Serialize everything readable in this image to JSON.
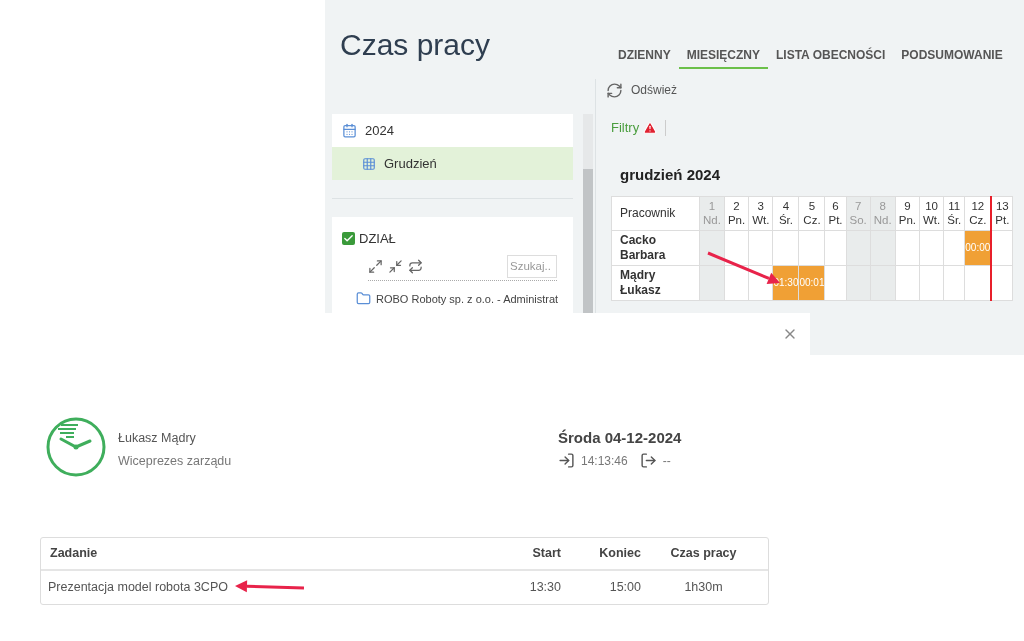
{
  "page": {
    "title": "Czas pracy"
  },
  "tabs": [
    {
      "label": "DZIENNY",
      "selected": false
    },
    {
      "label": "MIESIĘCZNY",
      "selected": true
    },
    {
      "label": "LISTA OBECNOŚCI",
      "selected": false
    },
    {
      "label": "PODSUMOWANIE",
      "selected": false
    }
  ],
  "toolbar": {
    "refresh": "Odśwież"
  },
  "filters": {
    "label": "Filtry",
    "warning": true
  },
  "calendar_tree": [
    {
      "label": "2024",
      "selected": false,
      "children": [
        {
          "label": "Grudzień",
          "selected": true
        }
      ]
    }
  ],
  "department": {
    "label": "DZIAŁ",
    "checked": true,
    "search_placeholder": "Szukaj..",
    "items": [
      {
        "label": "ROBO Roboty sp. z o.o. - Administrat"
      }
    ]
  },
  "schedule": {
    "title": "grudzień 2024",
    "employee_column": "Pracownik",
    "days": [
      {
        "day": "1",
        "weekday": "Nd.",
        "weekend": true,
        "today": false
      },
      {
        "day": "2",
        "weekday": "Pn.",
        "weekend": false,
        "today": false
      },
      {
        "day": "3",
        "weekday": "Wt.",
        "weekend": false,
        "today": false
      },
      {
        "day": "4",
        "weekday": "Śr.",
        "weekend": false,
        "today": false
      },
      {
        "day": "5",
        "weekday": "Cz.",
        "weekend": false,
        "today": false
      },
      {
        "day": "6",
        "weekday": "Pt.",
        "weekend": false,
        "today": false
      },
      {
        "day": "7",
        "weekday": "So.",
        "weekend": true,
        "today": false
      },
      {
        "day": "8",
        "weekday": "Nd.",
        "weekend": true,
        "today": false
      },
      {
        "day": "9",
        "weekday": "Pn.",
        "weekend": false,
        "today": false
      },
      {
        "day": "10",
        "weekday": "Wt.",
        "weekend": false,
        "today": false
      },
      {
        "day": "11",
        "weekday": "Śr.",
        "weekend": false,
        "today": false
      },
      {
        "day": "12",
        "weekday": "Cz.",
        "weekend": false,
        "today": false
      },
      {
        "day": "13",
        "weekday": "Pt.",
        "weekend": false,
        "today": true
      }
    ],
    "rows": [
      {
        "name": "Cacko Barbara",
        "cells": [
          {
            "filled": false
          },
          {
            "filled": false
          },
          {
            "filled": false
          },
          {
            "filled": false
          },
          {
            "filled": false
          },
          {
            "filled": false
          },
          {
            "filled": false
          },
          {
            "filled": false
          },
          {
            "filled": false
          },
          {
            "filled": false
          },
          {
            "filled": false
          },
          {
            "filled": true,
            "time": "00:00"
          },
          {
            "filled": false
          }
        ]
      },
      {
        "name": "Mądry Łukasz",
        "cells": [
          {
            "filled": false
          },
          {
            "filled": false
          },
          {
            "filled": false
          },
          {
            "filled": true,
            "time": "01:30"
          },
          {
            "filled": true,
            "time": "00:01"
          },
          {
            "filled": false
          },
          {
            "filled": false
          },
          {
            "filled": false
          },
          {
            "filled": false
          },
          {
            "filled": false
          },
          {
            "filled": false
          },
          {
            "filled": false
          },
          {
            "filled": false
          }
        ]
      }
    ]
  },
  "dialog": {
    "employee": {
      "name": "Łukasz Mądry",
      "position": "Wiceprezes zarządu"
    },
    "date": "Środa 04-12-2024",
    "clock_in": "14:13:46",
    "clock_out": "--",
    "tasks": {
      "columns": [
        "Zadanie",
        "Start",
        "Koniec",
        "Czas pracy"
      ],
      "rows": [
        {
          "cells": [
            "Prezentacja model robota 3CPO",
            "13:30",
            "15:00",
            "1h30m"
          ]
        }
      ]
    }
  }
}
